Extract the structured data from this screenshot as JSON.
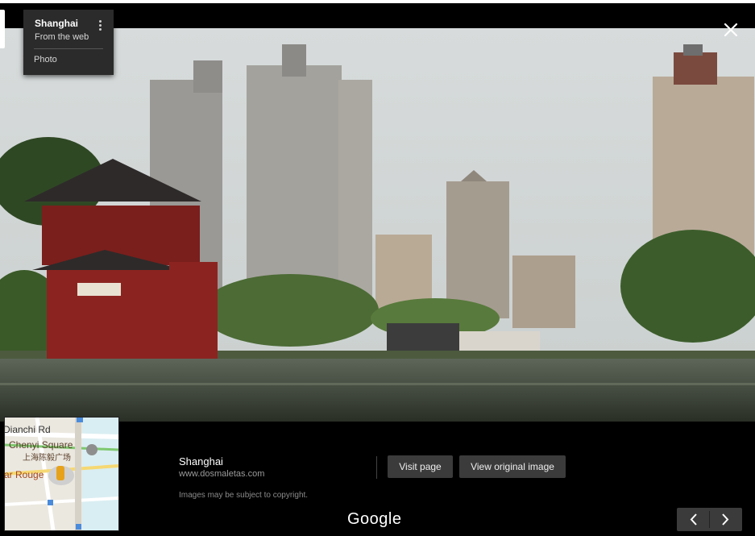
{
  "info_card": {
    "title": "Shanghai",
    "subtitle": "From the web",
    "type_label": "Photo"
  },
  "caption": {
    "title": "Shanghai",
    "url": "www.dosmaletas.com",
    "visit_label": "Visit page",
    "view_label": "View original image",
    "copyright": "Images may be subject to copyright."
  },
  "brand": "Google",
  "map": {
    "street_label": "Dianchi Rd",
    "place_label": "Chenyi Square",
    "place_label_cn": "上海陈毅广场",
    "bar_label": "ar Rouge"
  },
  "icons": {
    "close": "close-icon",
    "menu": "more-vert-icon",
    "prev": "chevron-left-icon",
    "next": "chevron-right-icon",
    "camera": "camera-pin-icon",
    "pegman": "pegman-icon",
    "bus": "bus-stop-icon"
  }
}
